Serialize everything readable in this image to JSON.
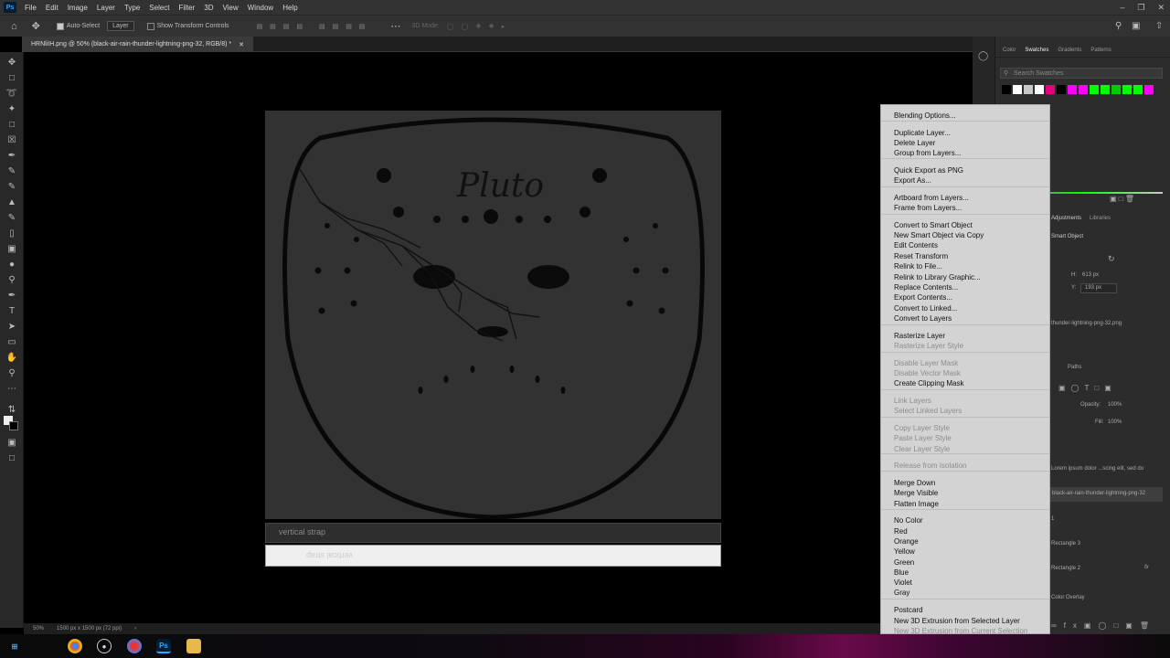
{
  "app": {
    "logo": "Ps"
  },
  "menubar": {
    "items": [
      "File",
      "Edit",
      "Image",
      "Layer",
      "Type",
      "Select",
      "Filter",
      "3D",
      "View",
      "Window",
      "Help"
    ]
  },
  "optionsbar": {
    "auto_select_label": "Auto-Select",
    "auto_select_target": "Layer",
    "show_transform_label": "Show Transform Controls",
    "mode_3d": "3D Mode:"
  },
  "document": {
    "tab_title": "HRNliIH.png @ 50% (black-air-rain-thunder-lightning-png-32, RGB/8) *",
    "art_text": "Pluto",
    "caption_1": "vertical strap",
    "caption_2": "vertical strap"
  },
  "status": {
    "zoom": "50%",
    "doc_info": "1500 px x 1500 px (72 ppi)"
  },
  "panels": {
    "tabs": [
      "Color",
      "Swatches",
      "Gradients",
      "Patterns"
    ],
    "active_tab": "Swatches",
    "search_placeholder": "Search Swatches",
    "swatch_colors": [
      "#000000",
      "#ffffff",
      "#c8c8c8",
      "#ffffff",
      "#e6007e",
      "#000000",
      "#ff00ff",
      "#ff00ff",
      "#00ff00",
      "#00ff00",
      "#00cc00",
      "#00ff00",
      "#00ff00",
      "#ff00ff"
    ],
    "props_tabs": [
      "Adjustments",
      "Libraries"
    ],
    "smart_object": "Smart Object",
    "w_label": "H:",
    "w_value": "613 px",
    "y_label": "Y:",
    "y_value": "193 px",
    "file_name": "thunder-lightning-png-32.png",
    "paths_tab": "Paths",
    "opacity_label": "Opacity:",
    "opacity_value": "100%",
    "fill_label": "Fill:",
    "fill_value": "100%",
    "layer_1": "Lorem ipsum dolor ...scing elit, sed do",
    "layer_2": "black-air-rain-thunder-lightning-png-32",
    "layer_3": "1",
    "layer_4": "Rectangle 3",
    "layer_5": "Rectangle 2",
    "layer_6": "Color Overlay",
    "fx": "fx"
  },
  "context_menu": {
    "items": [
      {
        "label": "Blending Options...",
        "disabled": false
      },
      {
        "label": "Duplicate Layer...",
        "disabled": false
      },
      {
        "label": "Delete Layer",
        "disabled": false
      },
      {
        "label": "Group from Layers...",
        "disabled": false
      },
      {
        "label": "Quick Export as PNG",
        "disabled": false
      },
      {
        "label": "Export As...",
        "disabled": false
      },
      {
        "label": "Artboard from Layers...",
        "disabled": false
      },
      {
        "label": "Frame from Layers...",
        "disabled": false
      },
      {
        "label": "Convert to Smart Object",
        "disabled": false
      },
      {
        "label": "New Smart Object via Copy",
        "disabled": false
      },
      {
        "label": "Edit Contents",
        "disabled": false
      },
      {
        "label": "Reset Transform",
        "disabled": false
      },
      {
        "label": "Relink to File...",
        "disabled": false
      },
      {
        "label": "Relink to Library Graphic...",
        "disabled": false
      },
      {
        "label": "Replace Contents...",
        "disabled": false
      },
      {
        "label": "Export Contents...",
        "disabled": false
      },
      {
        "label": "Convert to Linked...",
        "disabled": false
      },
      {
        "label": "Convert to Layers",
        "disabled": false
      },
      {
        "label": "Rasterize Layer",
        "disabled": false
      },
      {
        "label": "Rasterize Layer Style",
        "disabled": true
      },
      {
        "label": "Disable Layer Mask",
        "disabled": true
      },
      {
        "label": "Disable Vector Mask",
        "disabled": true
      },
      {
        "label": "Create Clipping Mask",
        "disabled": false
      },
      {
        "label": "Link Layers",
        "disabled": true
      },
      {
        "label": "Select Linked Layers",
        "disabled": true
      },
      {
        "label": "Copy Layer Style",
        "disabled": true
      },
      {
        "label": "Paste Layer Style",
        "disabled": true
      },
      {
        "label": "Clear Layer Style",
        "disabled": true
      },
      {
        "label": "Release from Isolation",
        "disabled": true
      },
      {
        "label": "Merge Down",
        "disabled": false
      },
      {
        "label": "Merge Visible",
        "disabled": false
      },
      {
        "label": "Flatten Image",
        "disabled": false
      },
      {
        "label": "No Color",
        "disabled": false
      },
      {
        "label": "Red",
        "disabled": false
      },
      {
        "label": "Orange",
        "disabled": false
      },
      {
        "label": "Yellow",
        "disabled": false
      },
      {
        "label": "Green",
        "disabled": false
      },
      {
        "label": "Blue",
        "disabled": false
      },
      {
        "label": "Violet",
        "disabled": false
      },
      {
        "label": "Gray",
        "disabled": false
      },
      {
        "label": "Postcard",
        "disabled": false
      },
      {
        "label": "New 3D Extrusion from Selected Layer",
        "disabled": false
      },
      {
        "label": "New 3D Extrusion from Current Selection",
        "disabled": true
      }
    ]
  }
}
